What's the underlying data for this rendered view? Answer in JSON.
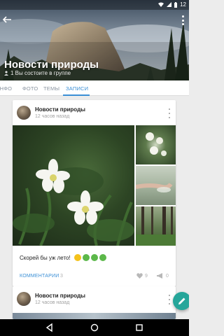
{
  "status_bar": {
    "time": "12"
  },
  "group": {
    "title": "Новости природы",
    "subtitle": "1 Вы состоите в группе"
  },
  "tabs": [
    {
      "label": "ИНФО",
      "active": false
    },
    {
      "label": "ФОТО",
      "active": false
    },
    {
      "label": "ТЕМЫ",
      "active": false
    },
    {
      "label": "ЗАПИСИ",
      "active": true
    }
  ],
  "posts": [
    {
      "author": "Новости природы",
      "time": "12 часов назад",
      "text": "Скорей бы уж лето!",
      "comments_label": "КОММЕНТАРИИ",
      "comments_count": "3",
      "likes": "9",
      "shares": "0"
    },
    {
      "author": "Новости природы",
      "time": "12 часов назад"
    }
  ],
  "colors": {
    "accent": "#3a8fd6",
    "fab": "#26a69a"
  }
}
